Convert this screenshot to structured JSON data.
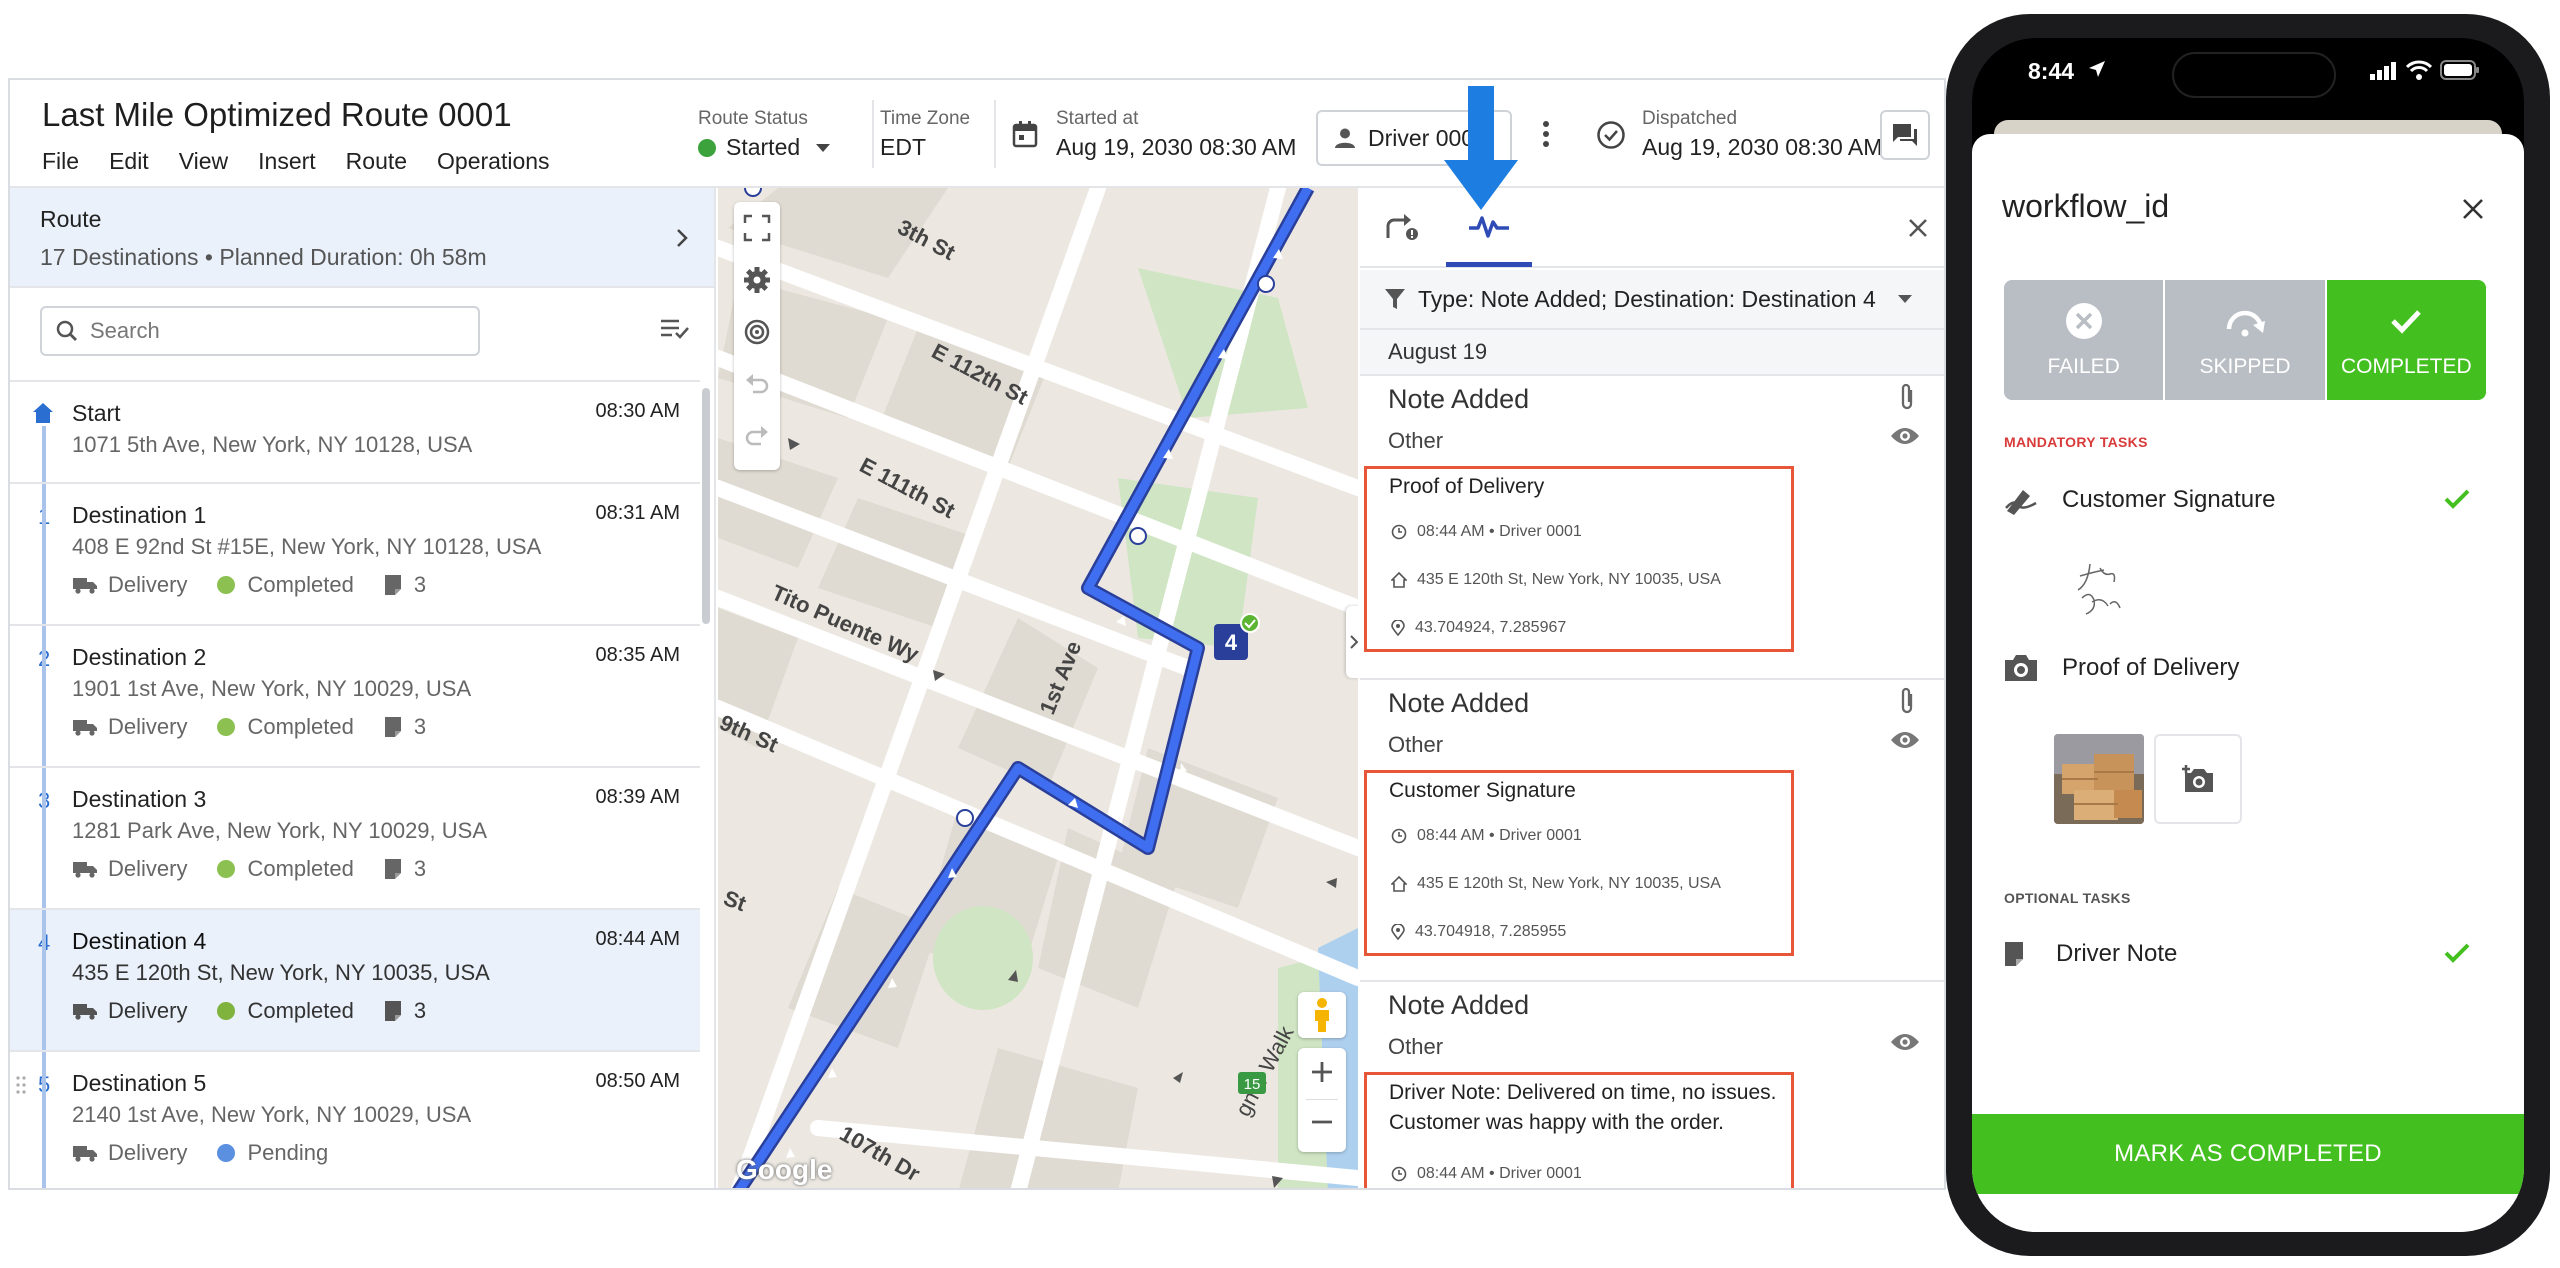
{
  "header": {
    "route_title": "Last Mile Optimized Route 0001",
    "menu": [
      "File",
      "Edit",
      "View",
      "Insert",
      "Route",
      "Operations"
    ],
    "route_status_label": "Route Status",
    "route_status_value": "Started",
    "timezone_label": "Time Zone",
    "timezone_value": "EDT",
    "started_label": "Started at",
    "started_value": "Aug 19, 2030 08:30 AM",
    "driver_button": "Driver 0001",
    "dispatched_label": "Dispatched",
    "dispatched_value": "Aug 19, 2030 08:30 AM"
  },
  "route_summary": {
    "title": "Route",
    "subtitle": "17 Destinations • Planned Duration: 0h 58m"
  },
  "search": {
    "placeholder": "Search"
  },
  "stops": [
    {
      "num": "",
      "name": "Start",
      "address": "1071 5th Ave, New York, NY 10128, USA",
      "time": "08:30 AM",
      "type": "",
      "status": "",
      "count": ""
    },
    {
      "num": "1",
      "name": "Destination 1",
      "address": "408 E 92nd St #15E, New York, NY 10128, USA",
      "time": "08:31 AM",
      "type": "Delivery",
      "status": "Completed",
      "count": "3"
    },
    {
      "num": "2",
      "name": "Destination 2",
      "address": "1901 1st Ave, New York, NY 10029, USA",
      "time": "08:35 AM",
      "type": "Delivery",
      "status": "Completed",
      "count": "3"
    },
    {
      "num": "3",
      "name": "Destination 3",
      "address": "1281 Park Ave, New York, NY 10029, USA",
      "time": "08:39 AM",
      "type": "Delivery",
      "status": "Completed",
      "count": "3"
    },
    {
      "num": "4",
      "name": "Destination 4",
      "address": "435 E 120th St, New York, NY 10035, USA",
      "time": "08:44 AM",
      "type": "Delivery",
      "status": "Completed",
      "count": "3"
    },
    {
      "num": "5",
      "name": "Destination 5",
      "address": "2140 1st Ave, New York, NY 10029, USA",
      "time": "08:50 AM",
      "type": "Delivery",
      "status": "Pending",
      "count": ""
    }
  ],
  "colors": {
    "completed": "#8cc152",
    "pending": "#5b8fe0",
    "accent": "#2f4bb5",
    "annotation": "#e8563a",
    "phone_green": "#43bf1f"
  },
  "map": {
    "streets": [
      "3th St",
      "E 112th St",
      "E 111th St",
      "Tito Puente Wy",
      "1st Ave",
      "9th St",
      "St",
      "107th Dr",
      "gner Walk"
    ],
    "route_badge": "4",
    "highway": "15",
    "attribution": "Google"
  },
  "activity": {
    "filter": "Type: Note Added; Destination: Destination 4",
    "date": "August 19",
    "notes": [
      {
        "title": "Note Added",
        "origin": "Other",
        "heading": "Proof of Delivery",
        "line2": "",
        "time": "08:44 AM • Driver 0001",
        "address": "435 E 120th St, New York, NY 10035, USA",
        "coords": "43.704924, 7.285967"
      },
      {
        "title": "Note Added",
        "origin": "Other",
        "heading": "Customer Signature",
        "line2": "",
        "time": "08:44 AM • Driver 0001",
        "address": "435 E 120th St, New York, NY 10035, USA",
        "coords": "43.704918, 7.285955"
      },
      {
        "title": "Note Added",
        "origin": "Other",
        "heading": "Driver Note: Delivered on time, no issues.",
        "line2": "Customer was happy with the order.",
        "time": "08:44 AM • Driver 0001",
        "address": "",
        "coords": ""
      }
    ]
  },
  "phone": {
    "clock": "8:44",
    "title": "workflow_id",
    "buttons": [
      "FAILED",
      "SKIPPED",
      "COMPLETED"
    ],
    "mandatory_label": "MANDATORY TASKS",
    "optional_label": "OPTIONAL TASKS",
    "tasks": {
      "signature": "Customer Signature",
      "photo": "Proof of Delivery",
      "note": "Driver Note"
    },
    "mark_button": "MARK AS COMPLETED"
  }
}
